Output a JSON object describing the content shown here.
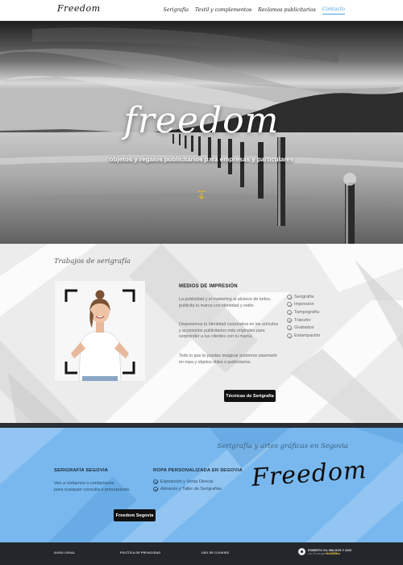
{
  "nav": {
    "logo": "Freedom",
    "items": [
      {
        "label": "Serigrafía",
        "active": false
      },
      {
        "label": "Textil y complementos",
        "active": false
      },
      {
        "label": "Reclamos publicitarios",
        "active": false
      },
      {
        "label": "Contacto",
        "active": true
      }
    ]
  },
  "hero": {
    "brand": "freedom",
    "tagline": "objetos y regalos publicitarios para empresas y particulares",
    "arrow_color": "#e0b82e"
  },
  "works": {
    "title": "Trabajos de serigrafía",
    "heading": "MEDIOS DE IMPRESIÓN",
    "paragraphs": [
      "La publicidad y el marketing al alcance de todos, publicita tu marca con identidad y estilo.",
      "Disponemos tu identidad corporativa en los artículos y accesorios publicitarios más originales para sorprender a tus clientes con tu marca.",
      "Todo lo que te puedas imaginar podemos plasmarlo en ropa y objetos útiles o publicitarios."
    ],
    "techniques": [
      "Serigrafía",
      "Impresión",
      "Tampografía",
      "Tránsfer",
      "Grabados",
      "Estampación"
    ],
    "button": "Técnicas de Serigrafía"
  },
  "contact": {
    "title": "Serigrafía y artes gráficas en Segovia",
    "col1": {
      "heading": "SERIGRAFÍA SEGOVIA",
      "line1": "Ven a visitarnos o contáctanos",
      "line2": "para cualquier consulta o presupuesto."
    },
    "col2": {
      "heading": "ROPA PERSONALIZADA EN SEGOVIA",
      "items": [
        "Exposición y Venta Directa",
        "Almacén y Taller de Serigrafías"
      ]
    },
    "button": "Freedom Segovia",
    "signature": "Freedom"
  },
  "footer": {
    "links": [
      "AVISO LEGAL",
      "POLÍTICA DE PRIVACIDAD",
      "USO DE COOKIES"
    ],
    "credit_title": "ROBERTO GIL MALDOS © 2023",
    "credit_prefix": "con Tecnología",
    "credit_brand": "WebWEBes"
  },
  "colors": {
    "accent": "#4aa3df",
    "contact_bg": "#78b8ee",
    "footer_bg": "#23272c"
  }
}
